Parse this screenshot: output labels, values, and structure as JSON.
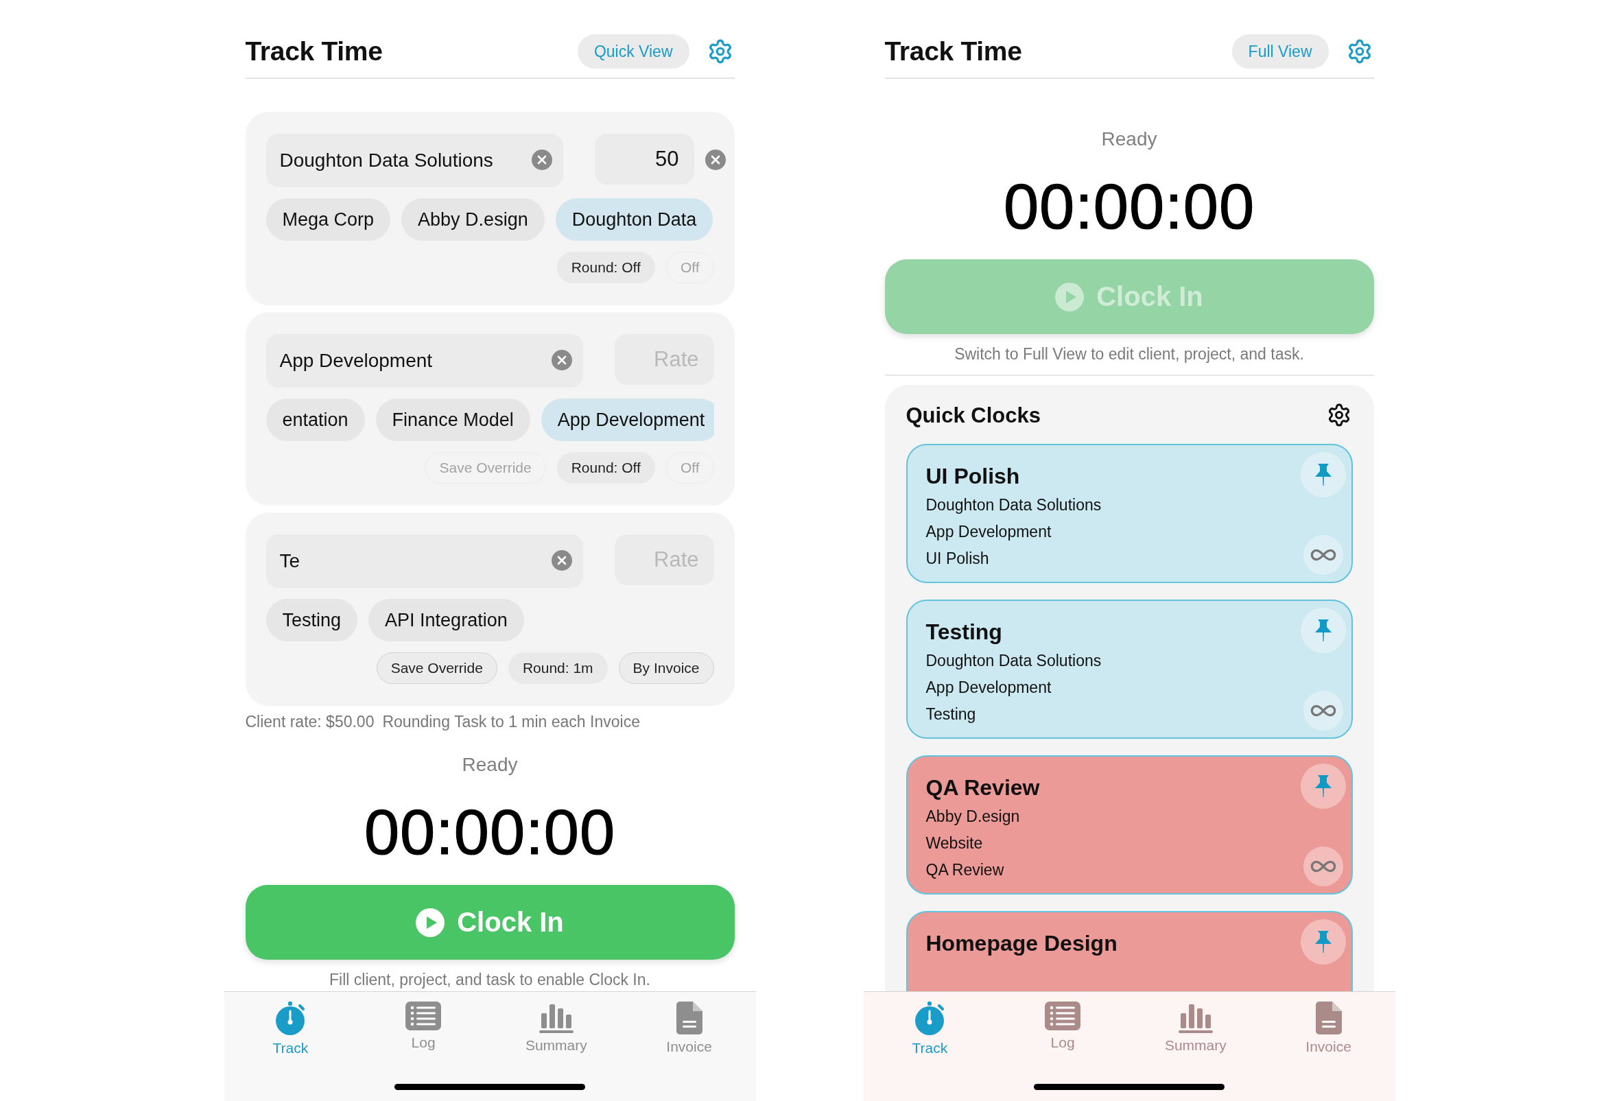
{
  "screens": [
    {
      "kind": "full",
      "title": "Track Time",
      "view_toggle": "Quick View",
      "editor": [
        {
          "field": {
            "value": "Doughton Data Solutions"
          },
          "rate": {
            "value": "50"
          },
          "rate_clear": true,
          "options": [
            {
              "label": "Mega Corp",
              "selected": false
            },
            {
              "label": "Abby D.esign",
              "selected": false
            },
            {
              "label": "Doughton Data",
              "selected": true
            }
          ],
          "actions": [
            {
              "label": "Round: Off",
              "kind": "round",
              "disabled": false
            },
            {
              "label": "Off",
              "kind": "outlined",
              "disabled": true
            }
          ]
        },
        {
          "field": {
            "value": "App Development"
          },
          "rate": {
            "placeholder": "Rate"
          },
          "rate_clear": false,
          "options": [
            {
              "label": "entation",
              "selected": false
            },
            {
              "label": "Finance Model",
              "selected": false
            },
            {
              "label": "App Development",
              "selected": true
            }
          ],
          "actions": [
            {
              "label": "Save Override",
              "kind": "outlined",
              "disabled": true
            },
            {
              "label": "Round: Off",
              "kind": "round",
              "disabled": false
            },
            {
              "label": "Off",
              "kind": "outlined",
              "disabled": true
            }
          ]
        },
        {
          "field": {
            "value": "Te"
          },
          "rate": {
            "placeholder": "Rate"
          },
          "rate_clear": false,
          "options": [
            {
              "label": "Testing",
              "selected": false
            },
            {
              "label": "API Integration",
              "selected": false
            }
          ],
          "actions": [
            {
              "label": "Save Override",
              "kind": "outlined",
              "disabled": false
            },
            {
              "label": "Round: 1m",
              "kind": "round",
              "disabled": false
            },
            {
              "label": "By Invoice",
              "kind": "outlined",
              "disabled": false
            }
          ]
        }
      ],
      "summary": [
        "Client rate: $50.00",
        "Rounding Task to 1 min each Invoice"
      ],
      "status": "Ready",
      "timer": "00:00:00",
      "clock_in": {
        "label": "Clock In",
        "disabled": false
      },
      "hint": "Fill client, project, and task to enable Clock In.",
      "tabs": [
        {
          "label": "Track",
          "selected": true
        },
        {
          "label": "Log",
          "selected": false
        },
        {
          "label": "Summary",
          "selected": false
        },
        {
          "label": "Invoice",
          "selected": false
        }
      ]
    },
    {
      "kind": "quick",
      "title": "Track Time",
      "view_toggle": "Full View",
      "status": "Ready",
      "timer": "00:00:00",
      "clock_in": {
        "label": "Clock In",
        "disabled": true
      },
      "hint": "Switch to Full View to edit client, project, and task.",
      "quick_clocks": {
        "title": "Quick Clocks",
        "items": [
          {
            "title": "UI Polish",
            "lines": [
              "Doughton Data Solutions",
              "App Development",
              "UI Polish"
            ],
            "color": "#cce9f2"
          },
          {
            "title": "Testing",
            "lines": [
              "Doughton Data Solutions",
              "App Development",
              "Testing"
            ],
            "color": "#cce9f2"
          },
          {
            "title": "QA Review",
            "lines": [
              "Abby D.esign",
              "Website",
              "QA Review"
            ],
            "color": "#ec9a97"
          },
          {
            "title": "Homepage Design",
            "color": "#ec9a97"
          }
        ]
      },
      "tabs": [
        {
          "label": "Track",
          "selected": true
        },
        {
          "label": "Log",
          "selected": false
        },
        {
          "label": "Summary",
          "selected": false
        },
        {
          "label": "Invoice",
          "selected": false
        }
      ]
    }
  ]
}
